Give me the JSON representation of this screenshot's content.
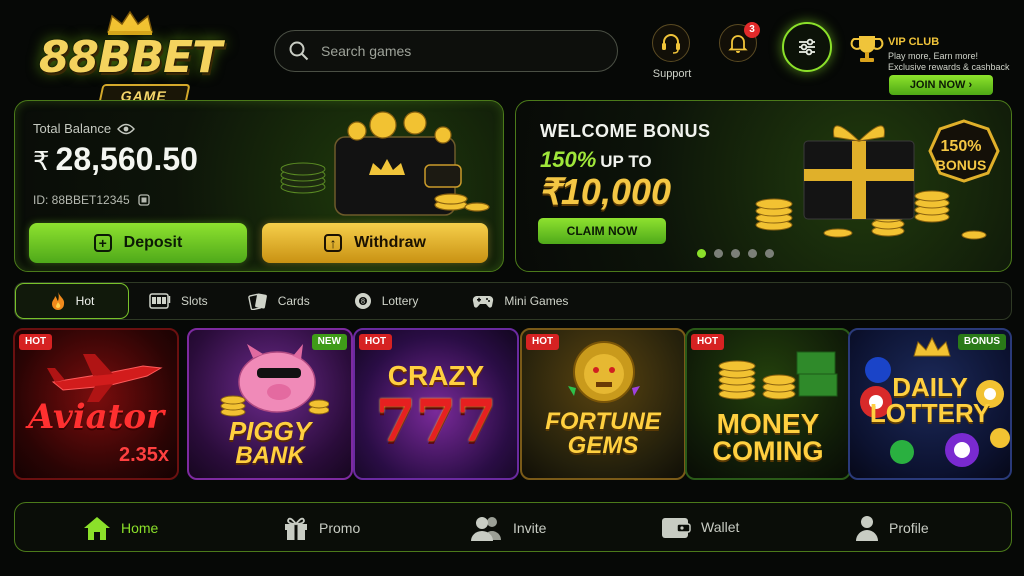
{
  "logo": {
    "brand": "88BBET",
    "sub": "GAME"
  },
  "search": {
    "placeholder": "Search games"
  },
  "header": {
    "support_label": "Support",
    "notifications_count": "3"
  },
  "vip": {
    "title": "VIP CLUB",
    "line1": "Play more, Earn more!",
    "line2": "Exclusive rewards & cashback",
    "join_label": "JOIN NOW"
  },
  "balance": {
    "label": "Total Balance",
    "currency": "₹",
    "amount": "28,560.50",
    "user_id": "ID: 88BBET12345",
    "deposit_label": "Deposit",
    "withdraw_label": "Withdraw"
  },
  "promo": {
    "headline": "WELCOME BONUS",
    "percent": "150%",
    "up_to": "UP TO",
    "amount": "₹10,000",
    "claim_label": "CLAIM NOW",
    "badge_percent": "150%",
    "badge_word": "BONUS",
    "slides": 5,
    "active_slide": 1
  },
  "tabs": [
    {
      "label": "Hot",
      "icon": "fire-icon"
    },
    {
      "label": "Slots",
      "icon": "slot-machine-icon"
    },
    {
      "label": "Cards",
      "icon": "cards-icon"
    },
    {
      "label": "Lottery",
      "icon": "lottery-ball-icon"
    },
    {
      "label": "Mini Games",
      "icon": "gamepad-icon"
    }
  ],
  "games": [
    {
      "tag": "HOT",
      "title": "Aviator",
      "extra": "2.35x"
    },
    {
      "tag": "NEW",
      "title": "PIGGY",
      "title2": "BANK"
    },
    {
      "tag": "HOT",
      "title": "CRAZY",
      "title2": "777"
    },
    {
      "tag": "HOT",
      "title": "FORTUNE",
      "title2": "GEMS"
    },
    {
      "tag": "HOT",
      "title": "MONEY",
      "title2": "COMING"
    },
    {
      "tag": "BONUS",
      "title": "DAILY",
      "title2": "LOTTERY"
    }
  ],
  "nav": [
    {
      "label": "Home",
      "icon": "home-icon"
    },
    {
      "label": "Promo",
      "icon": "gift-icon"
    },
    {
      "label": "Invite",
      "icon": "users-icon"
    },
    {
      "label": "Wallet",
      "icon": "wallet-icon"
    },
    {
      "label": "Profile",
      "icon": "user-icon"
    }
  ],
  "colors": {
    "accent": "#8be02a",
    "gold": "#f4c744",
    "hot_tag": "#d62222",
    "background": "#060806"
  }
}
